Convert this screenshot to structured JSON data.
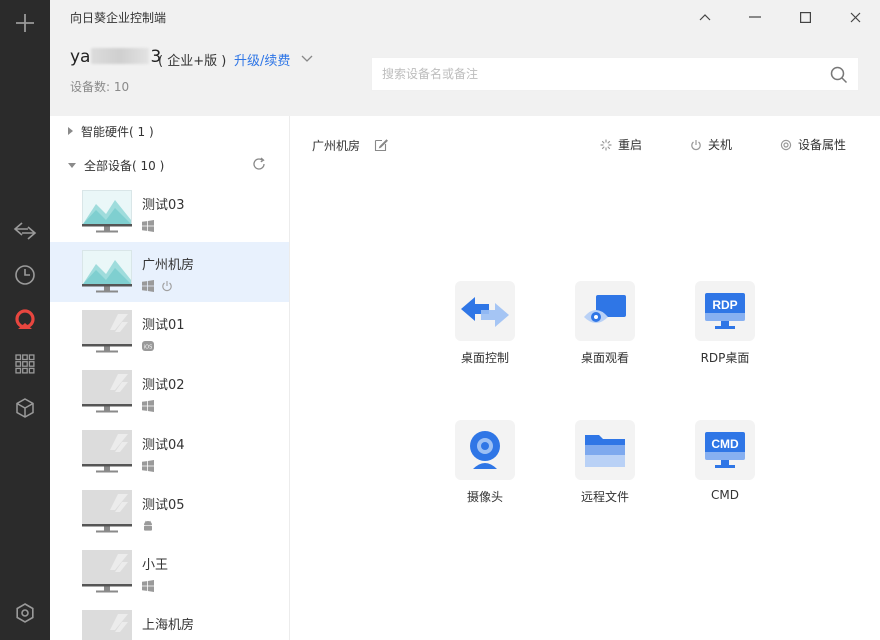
{
  "window": {
    "title": "向日葵企业控制端",
    "controls": [
      "collapse",
      "minimize",
      "maximize",
      "close"
    ]
  },
  "account": {
    "name_prefix": "ya",
    "name_suffix": "3",
    "edition": "( 企业+版 )",
    "upgrade_label": "升级/续费",
    "device_count": "设备数:  10"
  },
  "search": {
    "placeholder": "搜索设备名或备注"
  },
  "rail": {
    "items": [
      "add-icon",
      "remote-control-icon",
      "history-icon",
      "sunlogin-logo-icon",
      "apps-grid-icon",
      "cube-icon",
      "settings-icon"
    ],
    "active": "sunlogin-logo-icon",
    "accent": "#e8463f"
  },
  "groups": [
    {
      "label": "智能硬件( 1 )",
      "expanded": false
    },
    {
      "label": "全部设备( 10 )",
      "expanded": true
    }
  ],
  "devices": [
    {
      "name": "测试03",
      "os": "windows",
      "online": true,
      "selected": false
    },
    {
      "name": "广州机房",
      "os": "windows",
      "online": true,
      "selected": true,
      "power": true
    },
    {
      "name": "测试01",
      "os": "ios",
      "online": false,
      "selected": false
    },
    {
      "name": "测试02",
      "os": "windows",
      "online": false,
      "selected": false
    },
    {
      "name": "测试04",
      "os": "windows",
      "online": false,
      "selected": false
    },
    {
      "name": "测试05",
      "os": "android",
      "online": false,
      "selected": false
    },
    {
      "name": "小王",
      "os": "windows",
      "online": false,
      "selected": false
    },
    {
      "name": "上海机房",
      "os": "windows",
      "online": false,
      "selected": false
    }
  ],
  "detail": {
    "device_name": "广州机房",
    "actions": {
      "restart": "重启",
      "shutdown": "关机",
      "properties": "设备属性"
    },
    "features": [
      {
        "label": "桌面控制",
        "icon": "desktop-control-icon"
      },
      {
        "label": "桌面观看",
        "icon": "desktop-view-icon"
      },
      {
        "label": "RDP桌面",
        "icon": "rdp-desktop-icon",
        "badge": "RDP"
      },
      {
        "label": "摄像头",
        "icon": "camera-icon"
      },
      {
        "label": "远程文件",
        "icon": "remote-file-icon"
      },
      {
        "label": "CMD",
        "icon": "cmd-icon",
        "badge": "CMD"
      }
    ]
  },
  "colors": {
    "link": "#2f76e6",
    "selected_row": "#e8f1fd",
    "feature_blue": "#2f76e6"
  }
}
